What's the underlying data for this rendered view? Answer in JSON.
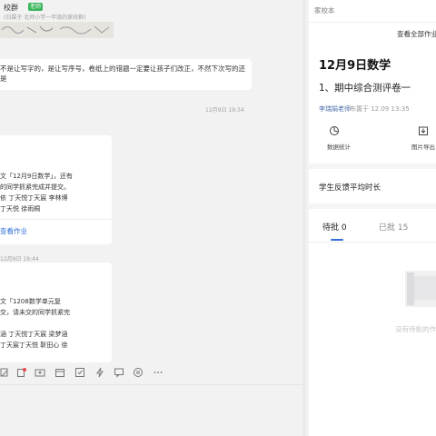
{
  "chat": {
    "group_name": "校群",
    "group_badge": "老师",
    "group_subtitle": "(归属于 北师小学一年级的家校群)",
    "message1": {
      "line1": "不是让写字的，是让写序号，卷纸上的错题一定要让孩子们改正，不然下次写的还",
      "line2": "是"
    },
    "time1": "12月9日 19:34",
    "card1": {
      "lines": [
        "文「12月9日数学」，还有",
        "的同学抓紧完成并提交。",
        "依  丁天悦丁天宸  李林博",
        "丁天悦  徐雨桐"
      ],
      "link": "查看作业"
    },
    "time2": "12月9日 19:44",
    "card2": {
      "lines": [
        "文「1208数学单元复",
        "交，请未交的同学抓紧完",
        "",
        "涵  丁天悦丁天宸  梁梦涵",
        "丁天宸丁天悦  靳田心  徐"
      ]
    },
    "toolbar_icons": [
      "clip-icon",
      "record-icon",
      "upload-icon",
      "calendar-icon",
      "edit-icon",
      "flash-icon",
      "chat-icon",
      "swap-icon",
      "more-icon"
    ]
  },
  "panel": {
    "app_name": "家校本",
    "view_all": "查看全部作业",
    "title": "12月9日数学",
    "subtitle": "1、期中综合测评卷一",
    "author": "李瑞娟老师",
    "meta": "布置于 12.09 13:35",
    "actions": [
      {
        "label": "数据统计",
        "icon": "pie-chart-icon"
      },
      {
        "label": "图片导出",
        "icon": "download-icon"
      }
    ],
    "feedback": "学生反馈平均时长",
    "tabs": {
      "pending_label": "待批",
      "pending_count": "0",
      "done_label": "已批",
      "done_count": "15"
    },
    "empty_text": "没有待批的作业",
    "accent": "#2f6fd6"
  }
}
